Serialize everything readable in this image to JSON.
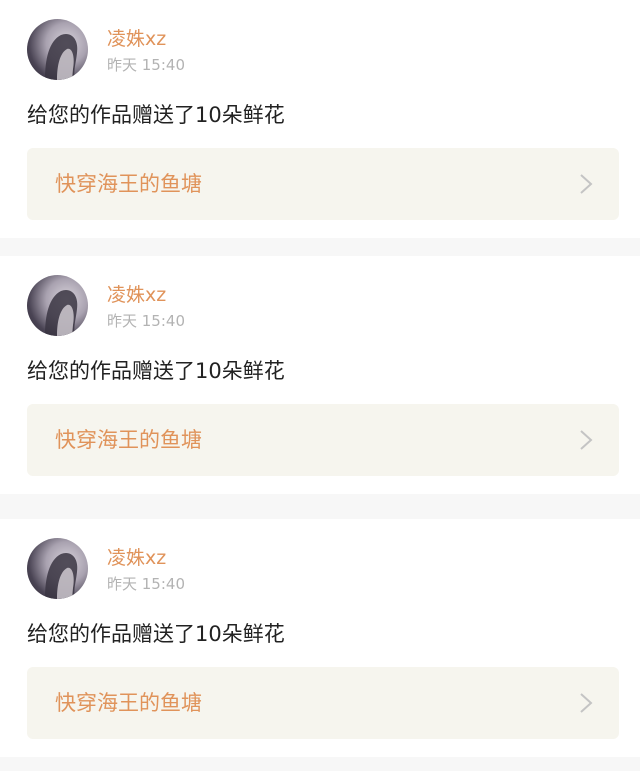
{
  "feed": {
    "items": [
      {
        "username": "凌姝xz",
        "timestamp": "昨天 15:40",
        "message": "给您的作品赠送了10朵鲜花",
        "work_title": "快穿海王的鱼塘",
        "avatar_icon": "user-avatar",
        "chevron_icon": "chevron-right-icon"
      },
      {
        "username": "凌姝xz",
        "timestamp": "昨天 15:40",
        "message": "给您的作品赠送了10朵鲜花",
        "work_title": "快穿海王的鱼塘",
        "avatar_icon": "user-avatar",
        "chevron_icon": "chevron-right-icon"
      },
      {
        "username": "凌姝xz",
        "timestamp": "昨天 15:40",
        "message": "给您的作品赠送了10朵鲜花",
        "work_title": "快穿海王的鱼塘",
        "avatar_icon": "user-avatar",
        "chevron_icon": "chevron-right-icon"
      }
    ]
  },
  "colors": {
    "accent": "#e0935a",
    "timestamp": "#b3b3b3",
    "text": "#222222",
    "link_bg": "#f6f5ee",
    "page_bg": "#f7f7f7",
    "card_bg": "#ffffff"
  }
}
